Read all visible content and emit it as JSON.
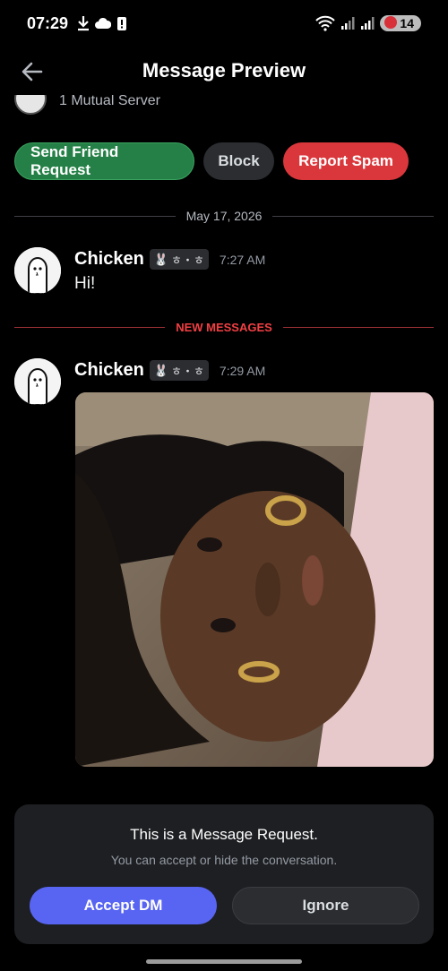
{
  "status_bar": {
    "time": "07:29",
    "battery": "14",
    "icons": [
      "download-icon",
      "cloud-icon",
      "alert-icon",
      "wifi-icon",
      "signal-icon",
      "signal-icon",
      "battery-icon"
    ]
  },
  "header": {
    "title": "Message Preview"
  },
  "profile": {
    "mutual_servers": "1 Mutual Server"
  },
  "actions": {
    "send_friend_request": "Send Friend Request",
    "block": "Block",
    "report_spam": "Report Spam"
  },
  "date_divider": "May 17, 2026",
  "new_messages_label": "NEW MESSAGES",
  "messages": [
    {
      "username": "Chicken",
      "tag": "ㅎ・ㅎ",
      "time": "7:27 AM",
      "text": "Hi!"
    },
    {
      "username": "Chicken",
      "tag": "ㅎ・ㅎ",
      "time": "7:29 AM",
      "attachment": "photo"
    }
  ],
  "request": {
    "title": "This is a Message Request.",
    "subtitle": "You can accept or hide the conversation.",
    "accept": "Accept DM",
    "ignore": "Ignore"
  },
  "colors": {
    "green": "#248046",
    "red": "#da373c",
    "blurple": "#5865f2",
    "new_messages_red": "#f23f43"
  }
}
